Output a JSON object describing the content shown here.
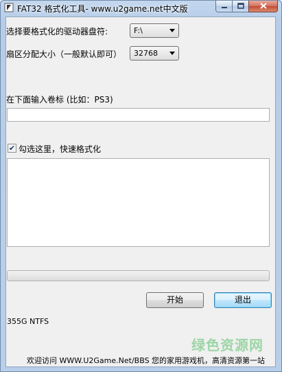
{
  "window": {
    "title": "FAT32 格式化工具- www.u2game.net中文版"
  },
  "drive": {
    "label": "选择要格式化的驱动器盘符:",
    "selected": "F:\\"
  },
  "sector": {
    "label": "扇区分配大小（一般默认即可）",
    "selected": "32768"
  },
  "volume": {
    "label": "在下面输入卷标 (比如：PS3)",
    "value": ""
  },
  "quick_format": {
    "label": "勾选这里，快速格式化",
    "checked": true
  },
  "log": {
    "text": ""
  },
  "progress": {
    "percent": 0
  },
  "buttons": {
    "start": "开始",
    "exit": "退出"
  },
  "status": {
    "drive_info": "355G NTFS"
  },
  "footer": {
    "text": "欢迎访问 WWW.U2Game.Net/BBS 您的家用游戏机，高清资源第一站"
  },
  "watermark": {
    "text": "绿色资源网"
  },
  "colors": {
    "progress_fill": "#34c33a",
    "window_frame": "#b9cfe9"
  }
}
